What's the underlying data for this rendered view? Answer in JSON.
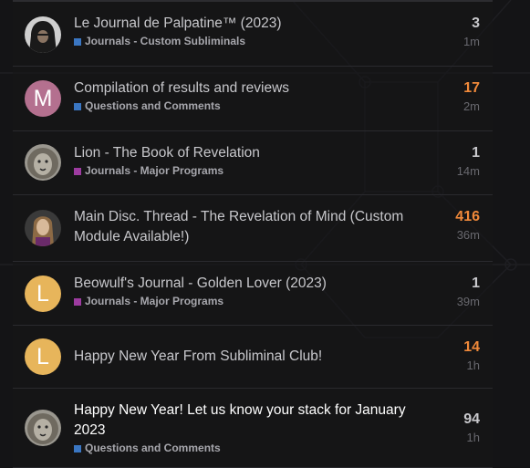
{
  "colors": {
    "journals_custom": "#3a76c2",
    "questions": "#3a76c2",
    "journals_major": "#9d3ba0",
    "hot_reply": "#f0893a"
  },
  "topics": [
    {
      "title": "Le Journal de Palpatine™ (2023)",
      "category": "Journals - Custom Subliminals",
      "replies": "3",
      "age": "1m",
      "avatar": "palpatine-avatar",
      "hot": false
    },
    {
      "title": "Compilation of results and reviews",
      "category": "Questions and Comments",
      "replies": "17",
      "age": "2m",
      "avatar_letter": "M",
      "hot": true
    },
    {
      "title": "Lion - The Book of Revelation",
      "category": "Journals - Major Programs",
      "replies": "1",
      "age": "14m",
      "avatar": "lion-avatar",
      "hot": false
    },
    {
      "title": "Main Disc. Thread - The Revelation of Mind (Custom Module Available!)",
      "category": "",
      "replies": "416",
      "age": "36m",
      "avatar": "longhair-avatar",
      "hot": true
    },
    {
      "title": "Beowulf's Journal - Golden Lover (2023)",
      "category": "Journals - Major Programs",
      "replies": "1",
      "age": "39m",
      "avatar_letter": "L",
      "hot": false
    },
    {
      "title": "Happy New Year From Subliminal Club!",
      "category": "",
      "replies": "14",
      "age": "1h",
      "avatar_letter": "L",
      "hot": true
    },
    {
      "title": "Happy New Year! Let us know your stack for January 2023",
      "category": "Questions and Comments",
      "replies": "94",
      "age": "1h",
      "avatar": "lion-avatar",
      "hot": false
    }
  ]
}
